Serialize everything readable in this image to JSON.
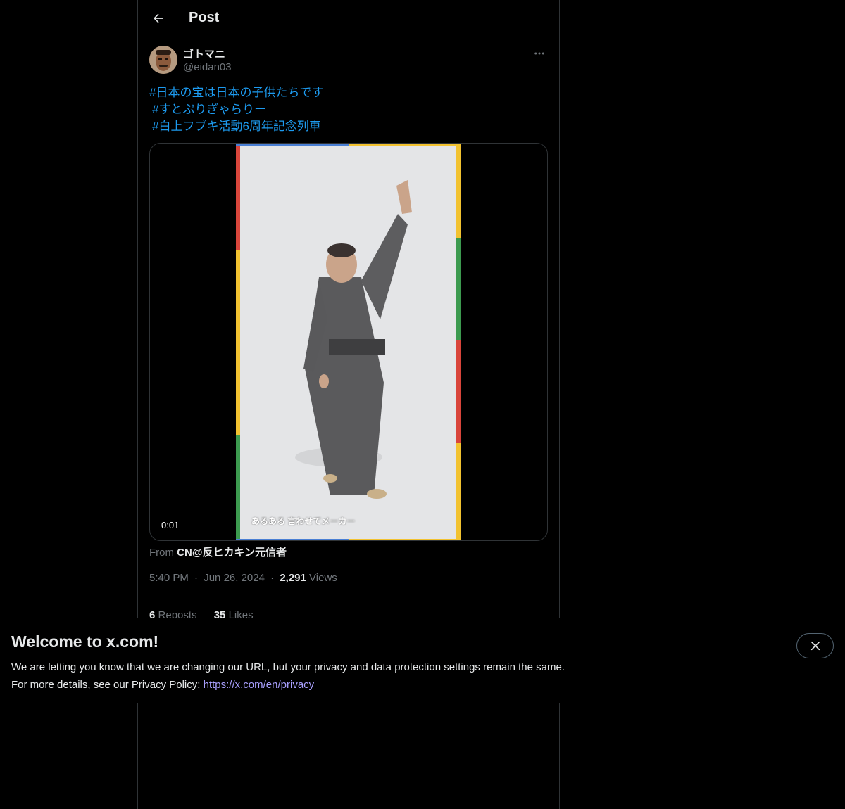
{
  "header": {
    "title": "Post"
  },
  "author": {
    "display_name": "ゴトマニ",
    "handle": "@eidan03"
  },
  "post": {
    "hashtags": [
      "#日本の宝は日本の子供たちです",
      "#すとぷりぎゃらりー",
      "#白上フブキ活動6周年記念列車"
    ],
    "video_time": "0:01",
    "video_caption": "あるある 言わせてメーカー"
  },
  "source": {
    "prefix": "From",
    "name": "CN@反ヒカキン元信者"
  },
  "meta": {
    "time": "5:40 PM",
    "date": "Jun 26, 2024",
    "views_count": "2,291",
    "views_label": "Views",
    "sep": "·"
  },
  "stats": {
    "reposts_count": "6",
    "reposts_label": "Reposts",
    "likes_count": "35",
    "likes_label": "Likes"
  },
  "banner": {
    "title": "Welcome to x.com!",
    "line1": "We are letting you know that we are changing our URL, but your privacy and data protection settings remain the same.",
    "line2_prefix": "For more details, see our Privacy Policy:",
    "link": "https://x.com/en/privacy"
  },
  "colors": {
    "accent": "#1d9bf0",
    "background": "#000000",
    "border": "#2f3336",
    "muted": "#71767b",
    "link_visited": "#a9a0ff"
  },
  "icons": {
    "back": "arrow-left-icon",
    "more": "more-horizontal-icon",
    "close": "close-icon"
  }
}
